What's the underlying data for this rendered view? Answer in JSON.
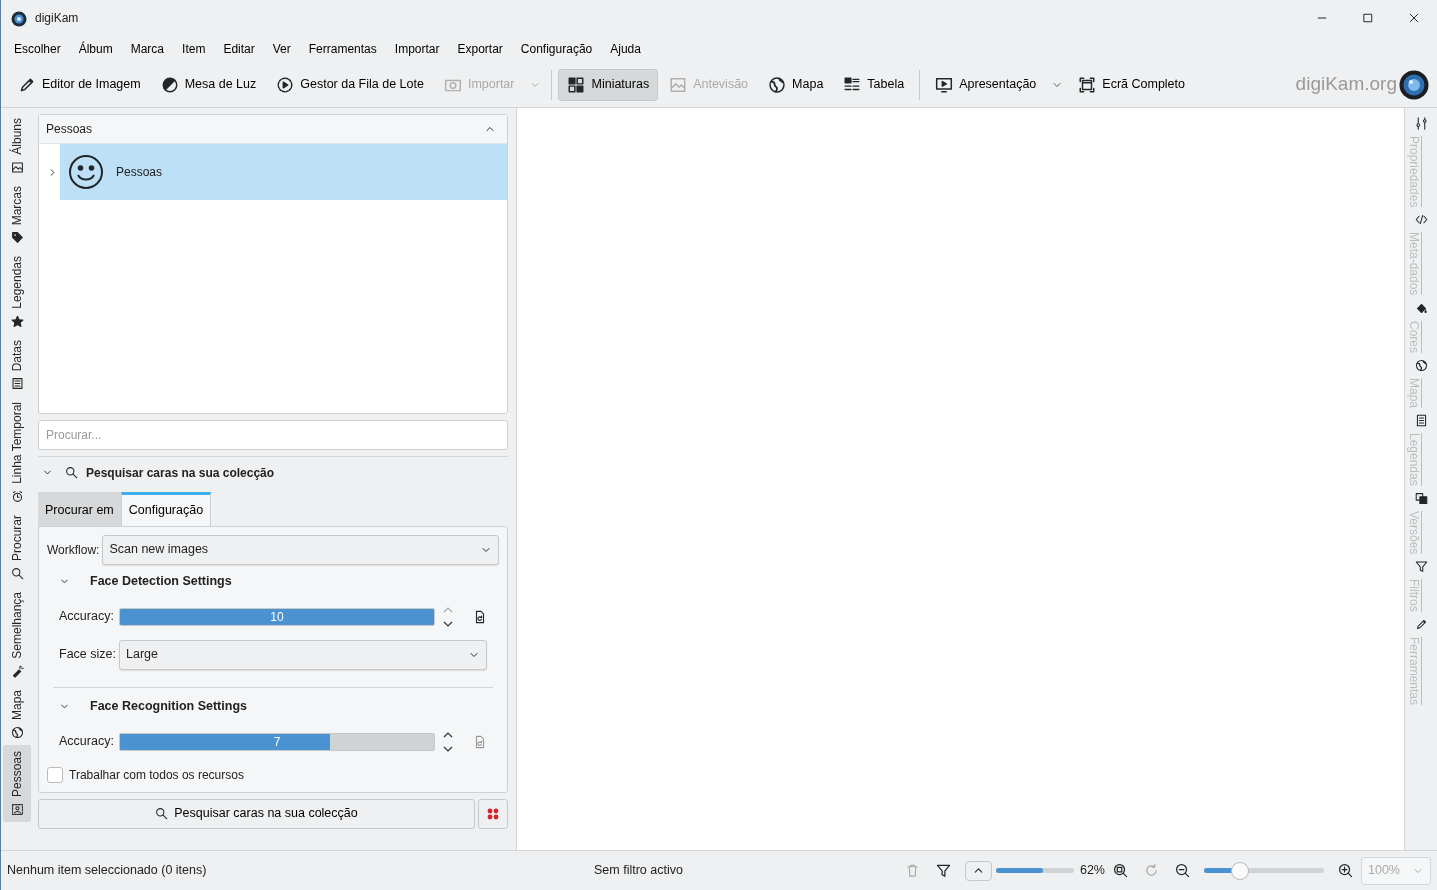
{
  "window": {
    "title": "digiKam"
  },
  "menu": [
    "Escolher",
    "Álbum",
    "Marca",
    "Item",
    "Editar",
    "Ver",
    "Ferramentas",
    "Importar",
    "Exportar",
    "Configuração",
    "Ajuda"
  ],
  "toolbar": [
    {
      "label": "Editor de Imagem",
      "disabled": false,
      "selected": false,
      "dropdown": false
    },
    {
      "label": "Mesa de Luz",
      "disabled": false,
      "selected": false,
      "dropdown": false
    },
    {
      "label": "Gestor da Fila de Lote",
      "disabled": false,
      "selected": false,
      "dropdown": false
    },
    {
      "label": "Importar",
      "disabled": true,
      "selected": false,
      "dropdown": true
    },
    {
      "label": "Miniaturas",
      "disabled": false,
      "selected": true,
      "dropdown": false
    },
    {
      "label": "Antevisão",
      "disabled": true,
      "selected": false,
      "dropdown": false
    },
    {
      "label": "Mapa",
      "disabled": false,
      "selected": false,
      "dropdown": false
    },
    {
      "label": "Tabela",
      "disabled": false,
      "selected": false,
      "dropdown": false
    },
    {
      "label": "Apresentação",
      "disabled": false,
      "selected": false,
      "dropdown": true
    },
    {
      "label": "Ecrã Completo",
      "disabled": false,
      "selected": false,
      "dropdown": false
    }
  ],
  "logo": "digiKam.org",
  "left_sidebar": [
    {
      "label": "Álbuns",
      "selected": false
    },
    {
      "label": "Marcas",
      "selected": false
    },
    {
      "label": "Legendas",
      "selected": false
    },
    {
      "label": "Datas",
      "selected": false
    },
    {
      "label": "Linha Temporal",
      "selected": false
    },
    {
      "label": "Procurar",
      "selected": false
    },
    {
      "label": "Semelhança",
      "selected": false
    },
    {
      "label": "Mapa",
      "selected": false
    },
    {
      "label": "Pessoas",
      "selected": true
    }
  ],
  "right_sidebar": [
    "Propriedades",
    "Meta-dados",
    "Cores",
    "Mapa",
    "Legendas",
    "Versões",
    "Filtros",
    "Ferramentas"
  ],
  "people_panel": {
    "title": "Pessoas",
    "tree": [
      {
        "label": "Pessoas",
        "expanded": false,
        "selected": true
      }
    ]
  },
  "search": {
    "placeholder": "Procurar..."
  },
  "face_search": {
    "title": "Pesquisar caras na sua colecção",
    "expanded": true,
    "tabs": [
      {
        "label": "Procurar em",
        "selected": false
      },
      {
        "label": "Configuração",
        "selected": true
      }
    ],
    "workflow_label": "Workflow:",
    "workflow": "Scan new images",
    "detection": {
      "title": "Face Detection Settings",
      "accuracy_label": "Accuracy:",
      "accuracy": "10",
      "level": 1.0,
      "size_label": "Face size:",
      "size": "Large"
    },
    "recognition": {
      "title": "Face Recognition Settings",
      "accuracy_label": "Accuracy:",
      "accuracy": "7",
      "level": 0.67
    },
    "all_resources": {
      "label": "Trabalhar com todos os recursos",
      "checked": false
    },
    "button": "Pesquisar caras na sua colecção"
  },
  "status_bar": {
    "selection": "Nenhum item seleccionado (0 itens)",
    "filter": "Sem filtro activo",
    "thumb_bar": {
      "level": 0.6
    },
    "thumb_size": "62%",
    "zoom_slider": {
      "level": 0.3
    },
    "zoom": "100%"
  }
}
